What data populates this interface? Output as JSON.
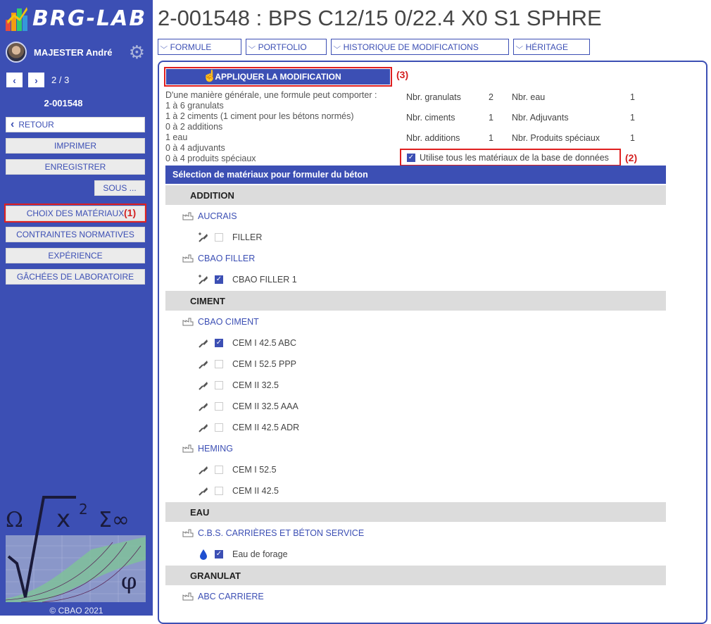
{
  "sidebar": {
    "logo_text": "BRG-LAB",
    "user_name": "MAJESTER André",
    "pager": "2 / 3",
    "formula_id": "2-001548",
    "back_label": "RETOUR",
    "print_label": "IMPRIMER",
    "save_label": "ENREGISTRER",
    "sub_label": "SOUS ...",
    "menu": [
      "CHOIX DES MATÉRIAUX",
      "CONTRAINTES NORMATIVES",
      "EXPÉRIENCE",
      "GÂCHÉES DE LABORATOIRE"
    ],
    "copyright": "© CBAO 2021"
  },
  "annotations": [
    "(1)",
    "(2)",
    "(3)"
  ],
  "page_title": "2-001548 : BPS C12/15 0/22.4 X0 S1 SPHRE",
  "tabs": [
    "FORMULE",
    "PORTFOLIO",
    "HISTORIQUE DE MODIFICATIONS",
    "HÉRITAGE"
  ],
  "apply_label": "APPLIQUER LA MODIFICATION",
  "intro_lines": [
    "D'une manière générale, une formule peut comporter :",
    "1 à 6 granulats",
    "1 à 2 ciments (1 ciment pour les bétons normés)",
    "0 à 2 additions",
    "1 eau",
    "0 à 4 adjuvants",
    "0 à 4 produits spéciaux"
  ],
  "stats": [
    {
      "label": "Nbr. granulats",
      "value": "2"
    },
    {
      "label": "Nbr. eau",
      "value": "1"
    },
    {
      "label": "Nbr. ciments",
      "value": "1"
    },
    {
      "label": "Nbr. Adjuvants",
      "value": "1"
    },
    {
      "label": "Nbr. additions",
      "value": "1"
    },
    {
      "label": "Nbr. Produits spéciaux",
      "value": "1"
    }
  ],
  "db_checkbox_label": "Utilise tous les matériaux de la base de données",
  "db_checkbox_checked": true,
  "selection_header": "Sélection de matériaux pour formuler du béton",
  "categories": [
    "ADDITION",
    "CIMENT",
    "EAU",
    "GRANULAT"
  ],
  "suppliers": [
    "AUCRAIS",
    "CBAO FILLER",
    "CBAO CIMENT",
    "HEMING",
    "C.B.S. CARRIÈRES ET BÉTON SERVICE",
    "ABC CARRIERE"
  ],
  "materials": [
    {
      "label": "FILLER",
      "checked": false,
      "icon": "trowel-plus-icon"
    },
    {
      "label": "CBAO FILLER 1",
      "checked": true,
      "icon": "trowel-plus-icon"
    },
    {
      "label": "CEM I 42.5 ABC",
      "checked": true,
      "icon": "trowel-icon"
    },
    {
      "label": "CEM I 52.5 PPP",
      "checked": false,
      "icon": "trowel-icon"
    },
    {
      "label": "CEM II 32.5",
      "checked": false,
      "icon": "trowel-icon"
    },
    {
      "label": "CEM II 32.5 AAA",
      "checked": false,
      "icon": "trowel-icon"
    },
    {
      "label": "CEM II 42.5 ADR",
      "checked": false,
      "icon": "trowel-icon"
    },
    {
      "label": "CEM I 52.5",
      "checked": false,
      "icon": "trowel-icon"
    },
    {
      "label": "CEM II 42.5",
      "checked": false,
      "icon": "trowel-icon"
    },
    {
      "label": "Eau de forage",
      "checked": true,
      "icon": "water-drop-icon"
    }
  ],
  "colors": {
    "primary": "#3c4fb4",
    "highlight": "#e02020",
    "category_bg": "#dcdcdc"
  }
}
